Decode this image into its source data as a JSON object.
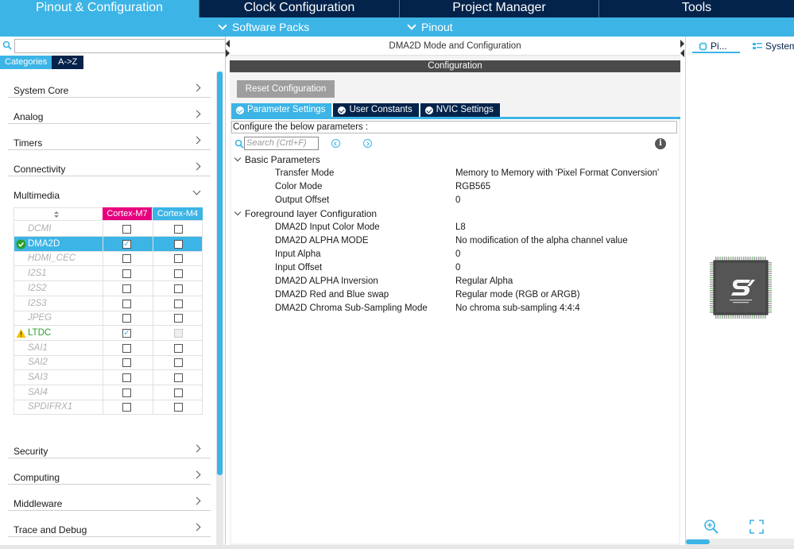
{
  "topnav": {
    "tabs": [
      "Pinout & Configuration",
      "Clock Configuration",
      "Project Manager",
      "Tools"
    ]
  },
  "subnav": {
    "software_packs": "Software Packs",
    "pinout": "Pinout"
  },
  "left": {
    "search_placeholder": "",
    "sort_categories": "Categories",
    "sort_az": "A->Z",
    "categories_top": [
      "System Core",
      "Analog",
      "Timers",
      "Connectivity",
      "Multimedia"
    ],
    "categories_bottom": [
      "Security",
      "Computing",
      "Middleware",
      "Trace and Debug"
    ],
    "core_headers": [
      "Cortex-M7",
      "Cortex-M4"
    ],
    "peripherals": [
      {
        "name": "DCMI"
      },
      {
        "name": "DMA2D"
      },
      {
        "name": "HDMI_CEC"
      },
      {
        "name": "I2S1"
      },
      {
        "name": "I2S2"
      },
      {
        "name": "I2S3"
      },
      {
        "name": "JPEG"
      },
      {
        "name": "LTDC"
      },
      {
        "name": "SAI1"
      },
      {
        "name": "SAI2"
      },
      {
        "name": "SAI3"
      },
      {
        "name": "SAI4"
      },
      {
        "name": "SPDIFRX1"
      }
    ],
    "colors": {
      "m7": "#e6007e",
      "m4": "#3cb4e6"
    }
  },
  "middle": {
    "title": "DMA2D Mode and Configuration",
    "config_bar": "Configuration",
    "reset_button": "Reset Configuration",
    "tabs": [
      "Parameter Settings",
      "User Constants",
      "NVIC Settings"
    ],
    "hint": "Configure the below parameters :",
    "search_placeholder": "Search (Crtl+F)",
    "groups": [
      {
        "title": "Basic Parameters",
        "params": [
          {
            "name": "Transfer Mode",
            "value": "Memory to Memory with 'Pixel Format Conversion'"
          },
          {
            "name": "Color Mode",
            "value": "RGB565"
          },
          {
            "name": "Output Offset",
            "value": "0"
          }
        ]
      },
      {
        "title": "Foreground layer Configuration",
        "params": [
          {
            "name": "DMA2D Input Color Mode",
            "value": "L8"
          },
          {
            "name": "DMA2D ALPHA MODE",
            "value": "No modification of the alpha channel value"
          },
          {
            "name": "Input Alpha",
            "value": "0"
          },
          {
            "name": "Input Offset",
            "value": "0"
          },
          {
            "name": "DMA2D ALPHA Inversion",
            "value": "Regular Alpha"
          },
          {
            "name": "DMA2D Red and Blue swap",
            "value": "Regular mode (RGB or ARGB)"
          },
          {
            "name": "DMA2D Chroma Sub-Sampling Mode",
            "value": "No chroma sub-sampling 4:4:4"
          }
        ]
      }
    ]
  },
  "right": {
    "tab_pinout": "Pi...",
    "tab_system": "System"
  }
}
